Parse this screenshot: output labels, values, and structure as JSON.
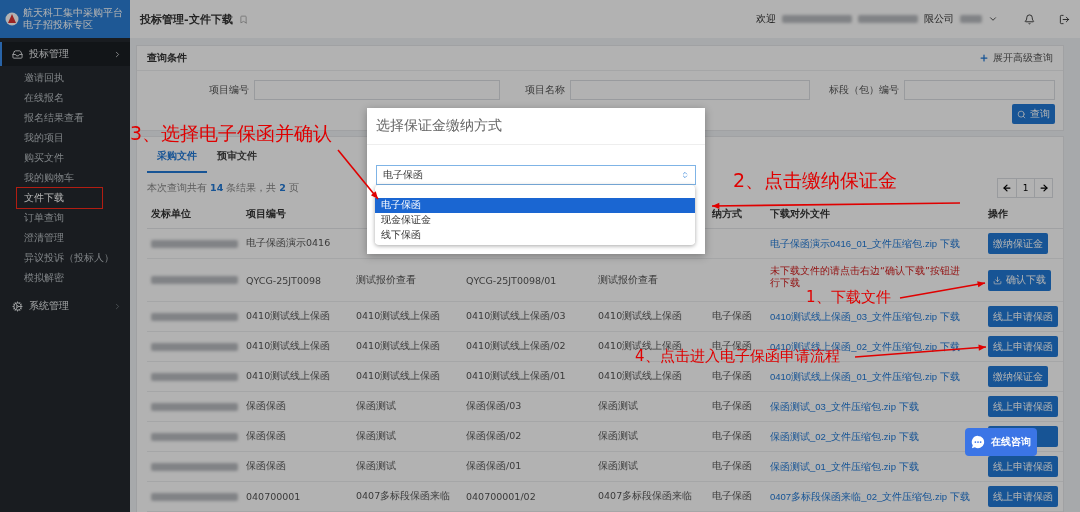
{
  "sidebar": {
    "logo_title": "航天科工集中采购平台",
    "logo_subtitle": "电子招投标专区",
    "groups": [
      {
        "label": "投标管理",
        "selected": true,
        "expanded": true,
        "items": [
          {
            "label": "邀请回执",
            "selected": false,
            "highlighted": false
          },
          {
            "label": "在线报名",
            "selected": false,
            "highlighted": false
          },
          {
            "label": "报名结果查看",
            "selected": false,
            "highlighted": false
          },
          {
            "label": "我的项目",
            "selected": false,
            "highlighted": false
          },
          {
            "label": "购买文件",
            "selected": false,
            "highlighted": false
          },
          {
            "label": "我的购物车",
            "selected": false,
            "highlighted": false
          },
          {
            "label": "文件下载",
            "selected": true,
            "highlighted": true
          },
          {
            "label": "订单查询",
            "selected": false,
            "highlighted": false
          },
          {
            "label": "澄清管理",
            "selected": false,
            "highlighted": false
          },
          {
            "label": "异议投诉（投标人）",
            "selected": false,
            "highlighted": false
          },
          {
            "label": "模拟解密",
            "selected": false,
            "highlighted": false
          }
        ]
      },
      {
        "label": "系统管理",
        "selected": false,
        "expanded": false
      }
    ]
  },
  "header": {
    "title": "投标管理-文件下载",
    "greeting": "欢迎",
    "company_suffix": "限公司"
  },
  "query": {
    "title": "查询条件",
    "advanced_link": "展开高级查询",
    "fields": [
      {
        "label": "项目编号"
      },
      {
        "label": "项目名称"
      },
      {
        "label": "标段（包）编号"
      }
    ],
    "search_button": "查询"
  },
  "tabs": [
    {
      "label": "采购文件",
      "selected": true
    },
    {
      "label": "预审文件",
      "selected": false
    }
  ],
  "result_summary": {
    "prefix": "本次查询共有",
    "count": "14",
    "middle": "条结果，共",
    "pages": "2",
    "suffix": "页"
  },
  "pagination": {
    "current": "1"
  },
  "table": {
    "columns": [
      {
        "label": "发标单位"
      },
      {
        "label": "项目编号"
      },
      {},
      {},
      {},
      {
        "label": "纳方式"
      },
      {
        "label": "下载对外文件"
      },
      {
        "label": "操作"
      }
    ],
    "rows": [
      {
        "cells": [
          "",
          "电子保函演示0416"
        ],
        "file": {
          "kind": "link",
          "text": "电子保函演示0416_01_文件压缩包.zip 下载"
        },
        "action": {
          "kind": "pay",
          "label": "缴纳保证金"
        }
      },
      {
        "cells": [
          "",
          "QYCG-25JT0098",
          "测试报价查看",
          "QYCG-25JT0098/01",
          "测试报价查看"
        ],
        "file": {
          "kind": "note",
          "text": "未下载文件的请点击右边“确认下载”按钮进行下载"
        },
        "action": {
          "kind": "confirm",
          "label": "确认下载"
        }
      },
      {
        "cells": [
          "",
          "0410测试线上保函",
          "0410测试线上保函",
          "0410测试线上保函/03",
          "0410测试线上保函",
          "电子保函"
        ],
        "file": {
          "kind": "link",
          "text": "0410测试线上保函_03_文件压缩包.zip 下载"
        },
        "action": {
          "kind": "apply",
          "label": "线上申请保函"
        }
      },
      {
        "cells": [
          "",
          "0410测试线上保函",
          "0410测试线上保函",
          "0410测试线上保函/02",
          "0410测试线上保函",
          "电子保函"
        ],
        "file": {
          "kind": "link",
          "text": "0410测试线上保函_02_文件压缩包.zip 下载"
        },
        "action": {
          "kind": "apply",
          "label": "线上申请保函"
        }
      },
      {
        "cells": [
          "",
          "0410测试线上保函",
          "0410测试线上保函",
          "0410测试线上保函/01",
          "0410测试线上保函",
          "电子保函"
        ],
        "file": {
          "kind": "link",
          "text": "0410测试线上保函_01_文件压缩包.zip 下载"
        },
        "action": {
          "kind": "pay",
          "label": "缴纳保证金"
        }
      },
      {
        "cells": [
          "",
          "保函保函",
          "保函测试",
          "保函保函/03",
          "保函测试",
          "电子保函"
        ],
        "file": {
          "kind": "link",
          "text": "保函测试_03_文件压缩包.zip 下载"
        },
        "action": {
          "kind": "apply",
          "label": "线上申请保函"
        }
      },
      {
        "cells": [
          "",
          "保函保函",
          "保函测试",
          "保函保函/02",
          "保函测试",
          "电子保函"
        ],
        "file": {
          "kind": "link",
          "text": "保函测试_02_文件压缩包.zip 下载"
        },
        "action": {
          "kind": "apply"
        }
      },
      {
        "cells": [
          "",
          "保函保函",
          "保函测试",
          "保函保函/01",
          "保函测试",
          "电子保函"
        ],
        "file": {
          "kind": "link",
          "text": "保函测试_01_文件压缩包.zip 下载"
        },
        "action": {
          "kind": "apply",
          "label": "线上申请保函"
        }
      },
      {
        "cells": [
          "",
          "040700001",
          "0407多标段保函来临",
          "040700001/02",
          "0407多标段保函来临",
          "电子保函"
        ],
        "file": {
          "kind": "link",
          "text": "0407多标段保函来临_02_文件压缩包.zip 下载"
        },
        "action": {
          "kind": "apply",
          "label": "线上申请保函"
        }
      }
    ]
  },
  "modal": {
    "title": "选择保证金缴纳方式",
    "select_value": "电子保函",
    "options": [
      {
        "label": "电子保函",
        "selected": true
      },
      {
        "label": "现金保证金",
        "selected": false
      },
      {
        "label": "线下保函",
        "selected": false
      }
    ]
  },
  "chat_widget": {
    "label": "在线咨询"
  },
  "annotations": [
    {
      "text": "3、选择电子保函并确认"
    },
    {
      "text": "2、点击缴纳保证金"
    },
    {
      "text": "1、下载文件"
    },
    {
      "text": "4、点击进入电子保函申请流程"
    }
  ]
}
